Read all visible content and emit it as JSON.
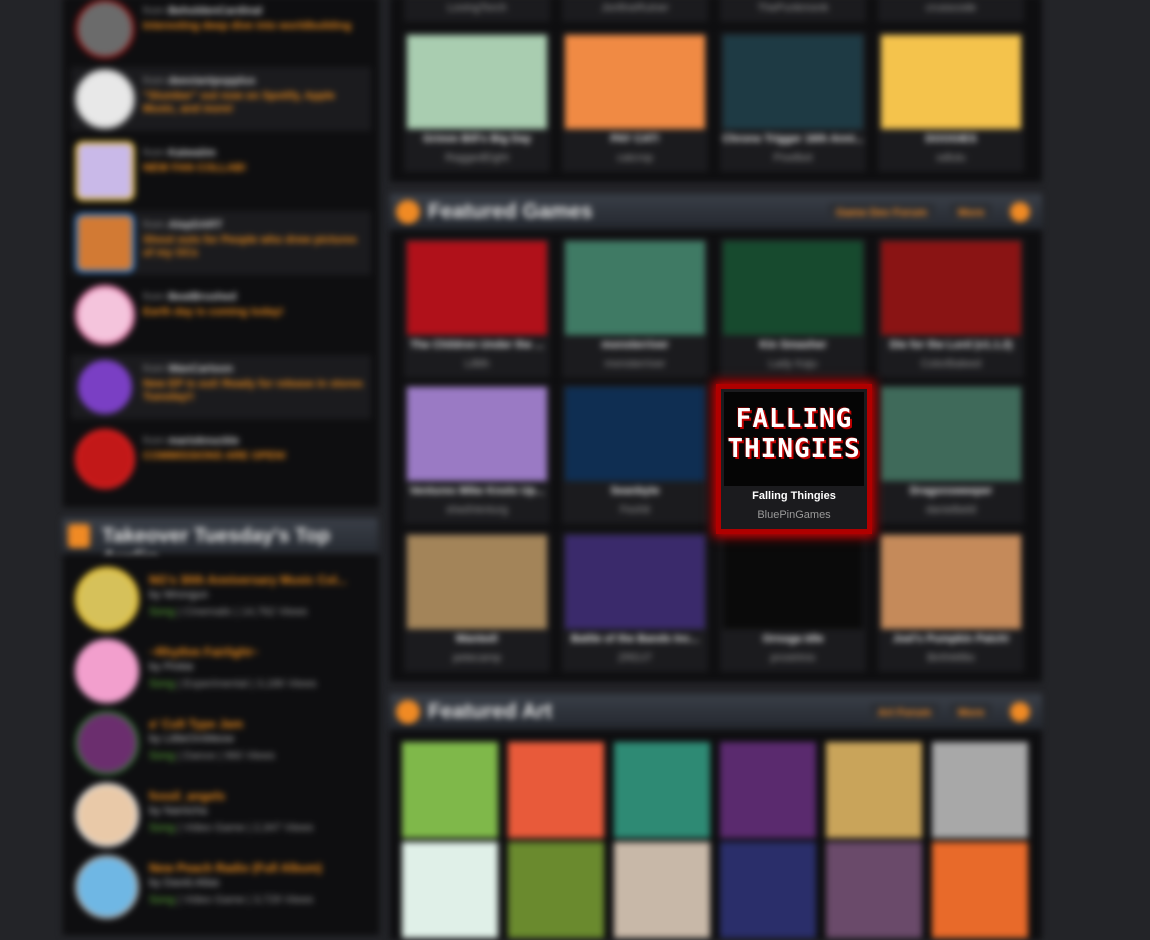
{
  "news": [
    {
      "by_prefix": "from",
      "author": "BeholdenCardinal",
      "headline": "Interesting deep dive into worldbuilding",
      "color": "#6b6b6b"
    },
    {
      "by_prefix": "from",
      "author": "deeviantpopplus",
      "headline": "\"Slumber\" out now on Spotify, Apple Music, and more!",
      "color": "#e8e8e8"
    },
    {
      "by_prefix": "from",
      "author": "Kaiwaiim",
      "headline": "NEW FAN COLLAB!",
      "color": "#c9b9e8"
    },
    {
      "by_prefix": "from",
      "author": "AlepDART",
      "headline": "Shout outs for People who drew pictures of my OCs",
      "color": "#d27a34"
    },
    {
      "by_prefix": "from",
      "author": "BeatBrushed",
      "headline": "Earth day is coming today!",
      "color": "#f4c4dc"
    },
    {
      "by_prefix": "from",
      "author": "WanCartoon",
      "headline": "New EP is out! Ready for release in stores Tuesday!!",
      "color": "#7a3fc4"
    },
    {
      "by_prefix": "from",
      "author": "marioknuckle",
      "headline": "COMMISSIONS ARE OPEN!",
      "color": "#c21818"
    }
  ],
  "audio": {
    "section_title": "Takeover Tuesday's Top Audio",
    "items": [
      {
        "title": "NG's 30th Anniversary Music Col...",
        "by_prefix": "by",
        "artist": "Wrongun",
        "genre": "Song",
        "meta": "| Cinematic | 14,762 Views",
        "color": "#d6c15a"
      },
      {
        "title": "~Rhythm Fairlight~",
        "by_prefix": "by",
        "artist": "Pinkie",
        "genre": "Song",
        "meta": "| Experimental | 3,186 Views",
        "color": "#f29fcd"
      },
      {
        "title": "a' Cult Type Jam",
        "by_prefix": "by",
        "artist": "LittleOmMeow",
        "genre": "Song",
        "meta": "| Dance | 960 Views",
        "color": "#6b2e6e"
      },
      {
        "title": "fossil_angels",
        "by_prefix": "by",
        "artist": "Namicha",
        "genre": "Song",
        "meta": "| Video Game | 2,347 Views",
        "color": "#e9c9a8"
      },
      {
        "title": "New Peach Radio (Full Album)",
        "by_prefix": "by",
        "artist": "David.Atlas",
        "genre": "Song",
        "meta": "| Video Game | 3,729 Views",
        "color": "#6fb7e4"
      }
    ]
  },
  "top_strip": [
    {
      "author": "LovingTorch",
      "color": "#1b1b1e"
    },
    {
      "author": "JonfineRuiner",
      "color": "#1b1b1e"
    },
    {
      "author": "ThePunkmonk",
      "color": "#1b1b1e"
    },
    {
      "author": "crusscode",
      "color": "#1b1b1e"
    }
  ],
  "top_games": [
    {
      "title": "Grimm Bill's Big Day",
      "author": "RaggedEight",
      "color": "#a9cdb0"
    },
    {
      "title": "PAY CAT!",
      "author": "catcrop",
      "color": "#f08a44"
    },
    {
      "title": "Chrono Trigger 16th Anni...",
      "author": "Pixelbot",
      "color": "#1e3a44"
    },
    {
      "title": "DOOGIES",
      "author": "odlulu",
      "color": "#f4c34c"
    }
  ],
  "featured_games": {
    "section_title": "Featured Games",
    "buttons": [
      "Game Dev Forum",
      "More"
    ],
    "items": [
      {
        "title": "The Children Under the ...",
        "author": "Lillith",
        "color": "#b0111a"
      },
      {
        "title": "monsterriver",
        "author": "monsterriver",
        "color": "#3f7a64"
      },
      {
        "title": "Kin Smasher",
        "author": "Lady Kaju",
        "color": "#174a2e"
      },
      {
        "title": "Die for the Lord (v1.1.2)",
        "author": "ColorBaleed",
        "color": "#8a1414"
      },
      {
        "title": "Ventures Mike Knots Up...",
        "author": "shedVenturg",
        "color": "#9a7ac4"
      },
      {
        "title": "Seanbyte",
        "author": "Fexhit",
        "color": "#0f2e52"
      },
      {
        "title": "Falling Thingies",
        "author": "BluePinGames",
        "color": "#000000",
        "logo": "FALLING THINGIES"
      },
      {
        "title": "Dragonsweeper",
        "author": "danielbeld",
        "color": "#3f6a5a"
      },
      {
        "title": "Wanted!",
        "author": "petecamp",
        "color": "#a38459"
      },
      {
        "title": "Battle of the Bands Inc...",
        "author": "ZRDJ7",
        "color": "#3a2a6b"
      },
      {
        "title": "Ornoga Idle",
        "author": "prostrtnix",
        "color": "#0a0a0a"
      },
      {
        "title": "Joel's Pumpkin Patch!",
        "author": "BirthMillio",
        "color": "#c58a5a"
      }
    ]
  },
  "featured_art": {
    "section_title": "Featured Art",
    "buttons": [
      "Art Forum",
      "More"
    ],
    "colors": [
      "#7fb84a",
      "#e85a3a",
      "#2e8a74",
      "#5a2a6e",
      "#c9a45a",
      "#a8a8a8",
      "#e0f0e8",
      "#6a8a2e",
      "#c8b8a8",
      "#2a2e6a",
      "#6a4a6a",
      "#e86a2a"
    ]
  }
}
